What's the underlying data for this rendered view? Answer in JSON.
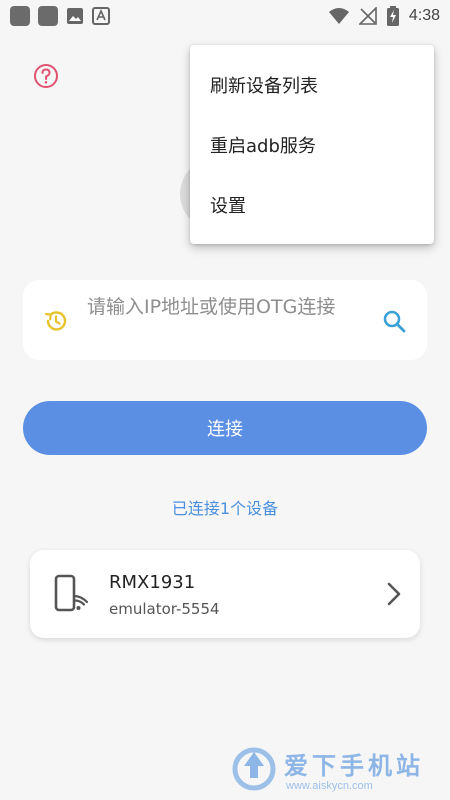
{
  "status_bar": {
    "time": "4:38"
  },
  "menu": {
    "items": [
      {
        "label": "刷新设备列表"
      },
      {
        "label": "重启adb服务"
      },
      {
        "label": "设置"
      }
    ]
  },
  "search": {
    "placeholder": "请输入IP地址或使用OTG连接"
  },
  "connect_button": {
    "label": "连接"
  },
  "connected_count": "已连接1个设备",
  "device": {
    "name": "RMX1931",
    "serial": "emulator-5554"
  },
  "watermark": {
    "title": "爱下手机站",
    "url": "www.aiskycn.com"
  },
  "colors": {
    "accent": "#5b8fe4",
    "link": "#4a8fe0",
    "help_icon": "#e0526f",
    "history_icon": "#e8c22a",
    "search_icon": "#3aa0d8"
  }
}
